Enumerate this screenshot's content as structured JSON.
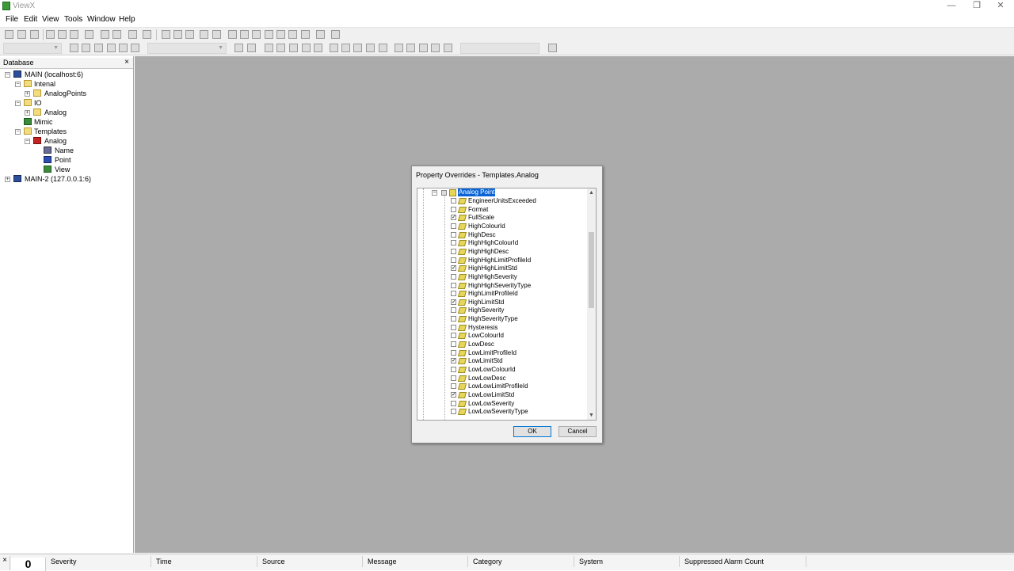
{
  "window": {
    "title": "ViewX"
  },
  "menu": [
    "File",
    "Edit",
    "View",
    "Tools",
    "Window",
    "Help"
  ],
  "database_panel": {
    "header": "Database",
    "close_glyph": "×",
    "tree": [
      {
        "label": "MAIN (localhost:6)",
        "icon": "server-icon",
        "toggle": "−"
      },
      {
        "label": "Intenal",
        "icon": "folder-icon",
        "toggle": "−"
      },
      {
        "label": "AnalogPoints",
        "icon": "folder-icon",
        "toggle": "+"
      },
      {
        "label": "IO",
        "icon": "folder-icon",
        "toggle": "−"
      },
      {
        "label": "Analog",
        "icon": "folder-icon",
        "toggle": "+"
      },
      {
        "label": "Mimic",
        "icon": "mimic-icon",
        "toggle": ""
      },
      {
        "label": "Templates",
        "icon": "folder-icon",
        "toggle": "−"
      },
      {
        "label": "Analog",
        "icon": "template-folder-icon",
        "toggle": "−"
      },
      {
        "label": "Name",
        "icon": "name-icon",
        "toggle": ""
      },
      {
        "label": "Point",
        "icon": "point-icon",
        "toggle": ""
      },
      {
        "label": "View",
        "icon": "view-icon",
        "toggle": ""
      },
      {
        "label": "MAIN-2 (127.0.0.1:6)",
        "icon": "server-icon",
        "toggle": "+"
      }
    ]
  },
  "dialog": {
    "title": "Property Overrides - Templates.Analog",
    "root_label": "Analog Point",
    "ok_label": "OK",
    "cancel_label": "Cancel",
    "items": [
      {
        "label": "EngineerUnitsExceeded",
        "checked": false
      },
      {
        "label": "Format",
        "checked": false
      },
      {
        "label": "FullScale",
        "checked": true
      },
      {
        "label": "HighColourId",
        "checked": false
      },
      {
        "label": "HighDesc",
        "checked": false
      },
      {
        "label": "HighHighColourId",
        "checked": false
      },
      {
        "label": "HighHighDesc",
        "checked": false
      },
      {
        "label": "HighHighLimitProfileId",
        "checked": false
      },
      {
        "label": "HighHighLimitStd",
        "checked": true
      },
      {
        "label": "HighHighSeverity",
        "checked": false
      },
      {
        "label": "HighHighSeverityType",
        "checked": false
      },
      {
        "label": "HighLimitProfileId",
        "checked": false
      },
      {
        "label": "HighLimitStd",
        "checked": true
      },
      {
        "label": "HighSeverity",
        "checked": false
      },
      {
        "label": "HighSeverityType",
        "checked": false
      },
      {
        "label": "Hysteresis",
        "checked": false
      },
      {
        "label": "LowColourId",
        "checked": false
      },
      {
        "label": "LowDesc",
        "checked": false
      },
      {
        "label": "LowLimitProfileId",
        "checked": false
      },
      {
        "label": "LowLimitStd",
        "checked": true
      },
      {
        "label": "LowLowColourId",
        "checked": false
      },
      {
        "label": "LowLowDesc",
        "checked": false
      },
      {
        "label": "LowLowLimitProfileId",
        "checked": false
      },
      {
        "label": "LowLowLimitStd",
        "checked": true
      },
      {
        "label": "LowLowSeverity",
        "checked": false
      },
      {
        "label": "LowLowSeverityType",
        "checked": false
      }
    ]
  },
  "alarm_bar": {
    "count": "0",
    "columns": [
      "Severity",
      "Time",
      "Source",
      "Message",
      "Category",
      "System",
      "Suppressed Alarm Count"
    ]
  },
  "colors": {
    "workspace": "#ababab",
    "selection": "#0a64d6"
  }
}
